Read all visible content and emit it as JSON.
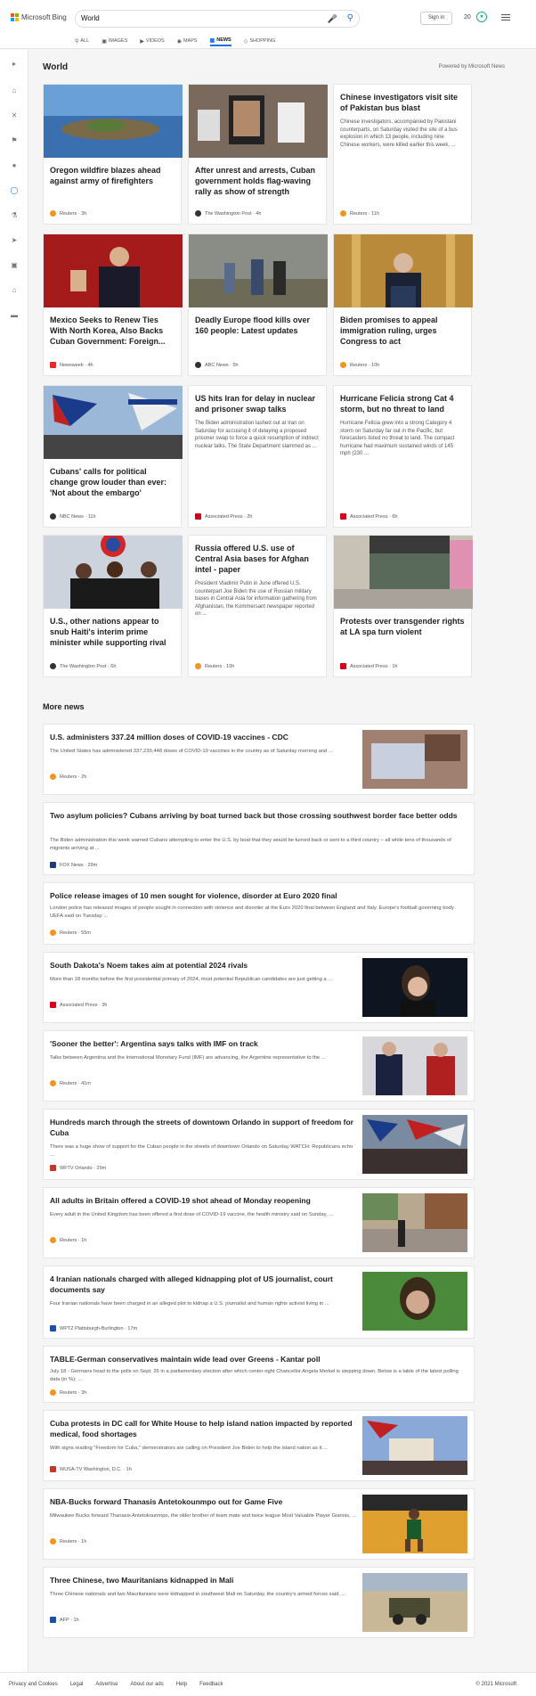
{
  "header": {
    "brand": "Microsoft Bing",
    "query": "World",
    "sign_in": "Sign in",
    "points": "20",
    "tabs": [
      {
        "label": "ALL",
        "icon": "search-icon"
      },
      {
        "label": "IMAGES",
        "icon": "image-icon"
      },
      {
        "label": "VIDEOS",
        "icon": "video-icon"
      },
      {
        "label": "MAPS",
        "icon": "map-pin-icon"
      },
      {
        "label": "NEWS",
        "icon": "news-icon",
        "active": true
      },
      {
        "label": "SHOPPING",
        "icon": "tag-icon"
      }
    ]
  },
  "sidebar": [
    "expand-icon",
    "home-icon",
    "tools-icon",
    "flag-icon",
    "map-pin-icon",
    "globe-icon",
    "science-icon",
    "rocket-icon",
    "film-icon",
    "bank-icon",
    "card-icon"
  ],
  "section": {
    "title": "World",
    "powered": "Powered by Microsoft News"
  },
  "cards": [
    {
      "title": "Oregon wildfire blazes ahead against army of firefighters",
      "desc": "",
      "source": "Reuters · 3h",
      "src_color": "#f29422"
    },
    {
      "title": "After unrest and arrests, Cuban government holds flag-waving rally as show of strength",
      "desc": "",
      "source": "The Washington Post · 4h",
      "src_color": "#333333"
    },
    {
      "title": "Chinese investigators visit site of Pakistan bus blast",
      "desc": "Chinese investigators, accompanied by Pakistani counterparts, on Saturday visited the site of a bus explosion in which 13 people, including nine Chinese workers, were killed earlier this week, ...",
      "source": "Reuters · 11h",
      "src_color": "#f29422"
    },
    {
      "title": "Mexico Seeks to Renew Ties With North Korea, Also Backs Cuban Government: Foreign...",
      "desc": "",
      "source": "Newsweek · 4h",
      "src_color": "#e32b2b"
    },
    {
      "title": "Deadly Europe flood kills over 160 people: Latest updates",
      "desc": "",
      "source": "ABC News · 5h",
      "src_color": "#333333"
    },
    {
      "title": "Biden promises to appeal immigration ruling, urges Congress to act",
      "desc": "",
      "source": "Reuters · 10h",
      "src_color": "#f29422"
    },
    {
      "title": "Cubans' calls for political change grow louder than ever: 'Not about the embargo'",
      "desc": "",
      "source": "NBC News · 11h",
      "src_color": "#333333"
    },
    {
      "title": "US hits Iran for delay in nuclear and prisoner swap talks",
      "desc": "The Biden administration lashed out at Iran on Saturday for accusing it of delaying a proposed prisoner swap to force a quick resumption of indirect nuclear talks. The State Department slammed as ...",
      "source": "Associated Press · 2h",
      "src_color": "#d0021b"
    },
    {
      "title": "Hurricane Felicia strong Cat 4 storm, but no threat to land",
      "desc": "Hurricane Felicia grew into a strong Category 4 storm on Saturday far out in the Pacific, but forecasters listed no threat to land. The compact hurricane had maximum sustained winds of 145 mph (230 ...",
      "source": "Associated Press · 6h",
      "src_color": "#d0021b"
    },
    {
      "title": "U.S., other nations appear to snub Haiti's interim prime minister while supporting rival",
      "desc": "",
      "source": "The Washington Post · 6h",
      "src_color": "#333333"
    },
    {
      "title": "Russia offered U.S. use of Central Asia bases for Afghan intel - paper",
      "desc": "President Vladimir Putin in June offered U.S. counterpart Joe Biden the use of Russian military bases in Central Asia for information gathering from Afghanistan, the Kommersant newspaper reported on ...",
      "source": "Reuters · 10h",
      "src_color": "#f29422"
    },
    {
      "title": "Protests over transgender rights at LA spa turn violent",
      "desc": "",
      "source": "Associated Press · 1h",
      "src_color": "#d0021b"
    }
  ],
  "more": {
    "title": "More news",
    "items": [
      {
        "title": "U.S. administers 337.24 million doses of COVID-19 vaccines - CDC",
        "desc": "The United States has administered 337,239,448 doses of COVID-19 vaccines in the country as of Saturday morning and ...",
        "source": "Reuters · 2h",
        "src_color": "#f29422"
      },
      {
        "title": "Two asylum policies? Cubans arriving by boat turned back but those crossing southwest border face better odds",
        "desc": "The Biden administration this week warned Cubans attempting to enter the U.S. by boat that they would be turned back or sent to a third country – all while tens of thousands of migrants arriving at ...",
        "source": "FOX News · 29m",
        "src_color": "#1f3a7a"
      },
      {
        "title": "Police release images of 10 men sought for violence, disorder at Euro 2020 final",
        "desc": "London police has released images of people sought in connection with violence and disorder at the Euro 2020 final between England and Italy. Europe's football governing body UEFA said on Tuesday ...",
        "source": "Reuters · 55m",
        "src_color": "#f29422"
      },
      {
        "title": "South Dakota's Noem takes aim at potential 2024 rivals",
        "desc": "More than 18 months before the first presidential primary of 2024, most potential Republican candidates are just getting a ...",
        "source": "Associated Press · 3h",
        "src_color": "#d0021b"
      },
      {
        "title": "'Sooner the better': Argentina says talks with IMF on track",
        "desc": "Talks between Argentina and the International Monetary Fund (IMF) are advancing, the Argentine representative to the ...",
        "source": "Reuters · 41m",
        "src_color": "#f29422"
      },
      {
        "title": "Hundreds march through the streets of downtown Orlando in support of freedom for Cuba",
        "desc": "There was a huge show of support for the Cuban people in the streets of downtown Orlando on Saturday WATCH: Republicans echo ...",
        "source": "WFTV Orlando · 29m",
        "src_color": "#c0392b"
      },
      {
        "title": "All adults in Britain offered a COVID-19 shot ahead of Monday reopening",
        "desc": "Every adult in the United Kingdom has been offered a first dose of COVID-19 vaccine, the health ministry said on Sunday, ...",
        "source": "Reuters · 1h",
        "src_color": "#f29422"
      },
      {
        "title": "4 Iranian nationals charged with alleged kidnapping plot of US journalist, court documents say",
        "desc": "Four Iranian nationals have been charged in an alleged plot to kidnap a U.S. journalist and human rights activist living in ...",
        "source": "WPTZ Plattsburgh-Burlington · 17m",
        "src_color": "#1f4fa0"
      },
      {
        "title": "TABLE-German conservatives maintain wide lead over Greens - Kantar poll",
        "desc": "July 18 - Germans head to the polls on Sept. 26 in a parliamentary election after which center-right Chancellor Angela Merkel is stepping down. Below is a table of the latest polling data (in %): ...",
        "source": "Reuters · 3h",
        "src_color": "#f29422"
      },
      {
        "title": "Cuba protests in DC call for White House to help island nation impacted by reported medical, food shortages",
        "desc": "With signs reading \"Freedom for Cuba,\" demonstrators are calling on President Joe Biden to help the island nation as it ...",
        "source": "WUSA-TV Washington, D.C. · 1h",
        "src_color": "#c0392b"
      },
      {
        "title": "NBA-Bucks forward Thanasis Antetokounmpo out for Game Five",
        "desc": "Milwaukee Bucks forward Thanasis Antetokounmpo, the older brother of team mate and twice league Most Valuable Player Giannis, ...",
        "source": "Reuters · 1h",
        "src_color": "#f29422"
      },
      {
        "title": "Three Chinese, two Mauritanians kidnapped in Mali",
        "desc": "Three Chinese nationals and two Mauritanians were kidnapped in southwest Mali on Saturday, the country's armed forces said, ...",
        "source": "AFP · 1h",
        "src_color": "#1f4fa0"
      }
    ]
  },
  "footer": {
    "links": [
      "Privacy and Cookies",
      "Legal",
      "Advertise",
      "About our ads",
      "Help",
      "Feedback"
    ],
    "copyright": "© 2021 Microsoft"
  }
}
